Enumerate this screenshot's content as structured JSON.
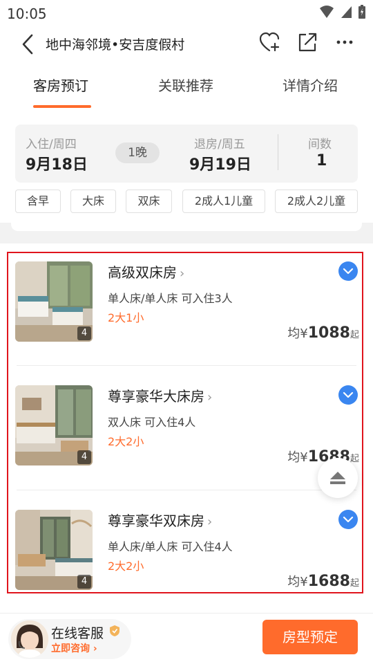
{
  "status_bar": {
    "time": "10:05"
  },
  "header": {
    "title": "地中海邻境•安吉度假村"
  },
  "tabs": [
    {
      "label": "客房预订",
      "active": true
    },
    {
      "label": "关联推荐",
      "active": false
    },
    {
      "label": "详情介绍",
      "active": false
    }
  ],
  "dates": {
    "checkin_label": "入住/周四",
    "checkin_date": "9月18日",
    "nights": "1晚",
    "checkout_label": "退房/周五",
    "checkout_date": "9月19日",
    "rooms_label": "间数",
    "rooms_value": "1"
  },
  "filters": [
    "含早",
    "大床",
    "双床",
    "2成人1儿童",
    "2成人2儿童"
  ],
  "rooms": [
    {
      "name": "高级双床房",
      "bed": "单人床/单人床 可入住3人",
      "occupancy": "2大1小",
      "price_prefix": "均¥",
      "price": "1088",
      "price_suffix": "起",
      "image_count": "4"
    },
    {
      "name": "尊享豪华大床房",
      "bed": "双人床 可入住4人",
      "occupancy": "2大2小",
      "price_prefix": "均¥",
      "price": "1688",
      "price_suffix": "起",
      "image_count": "4"
    },
    {
      "name": "尊享豪华双床房",
      "bed": "单人床/单人床 可入住4人",
      "occupancy": "2大2小",
      "price_prefix": "均¥",
      "price": "1688",
      "price_suffix": "起",
      "image_count": "4"
    }
  ],
  "bottom": {
    "service_title": "在线客服",
    "service_sub": "立即咨询",
    "book_label": "房型预定"
  },
  "colors": {
    "accent": "#ff6b2c",
    "check_blue": "#3a86f0",
    "highlight_border": "#e0141c"
  },
  "icons": [
    "back-arrow-icon",
    "heart-plus-icon",
    "share-icon",
    "more-icon",
    "chevron-right-icon",
    "check-circle-icon",
    "eject-icon",
    "shield-icon"
  ]
}
